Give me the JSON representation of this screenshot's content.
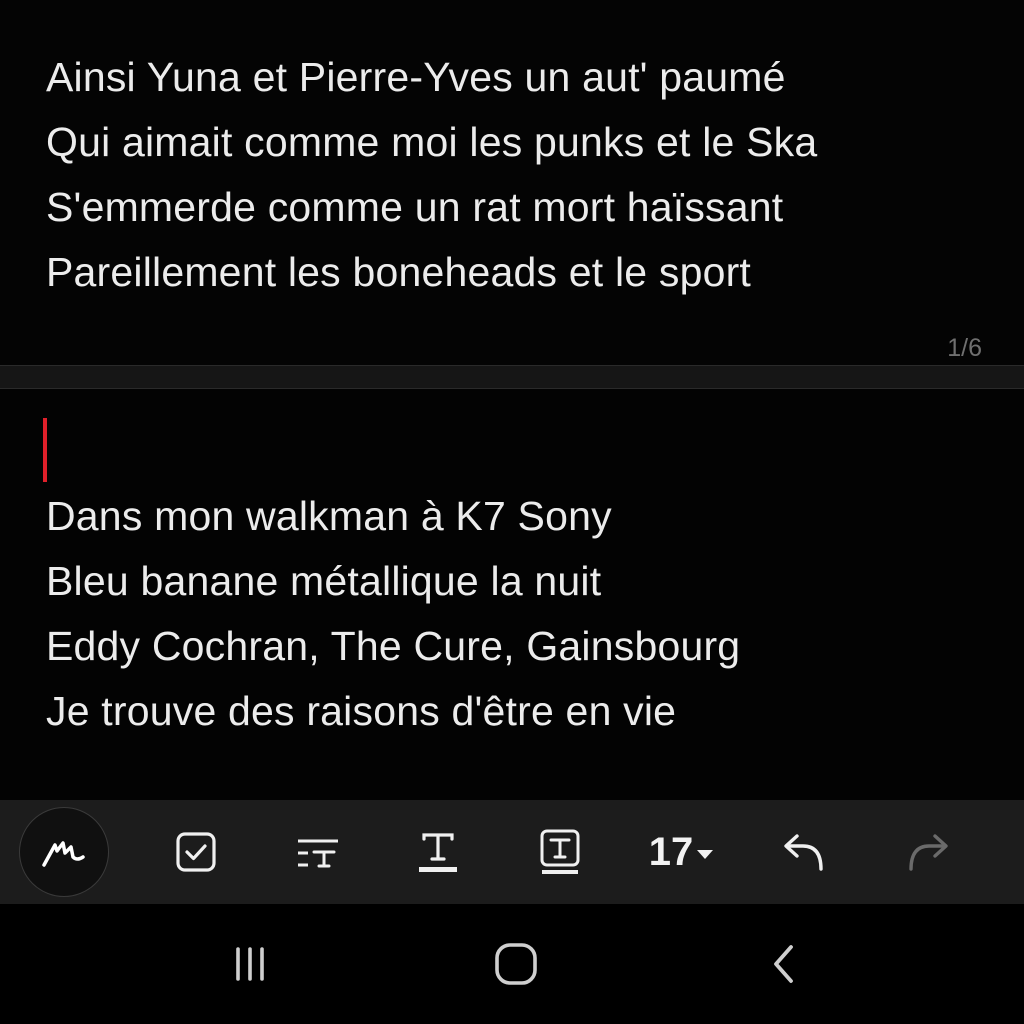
{
  "note": {
    "top_lines": [
      "Ainsi Yuna et Pierre-Yves un aut' paumé",
      "Qui aimait comme moi les punks et le Ska",
      "S'emmerde comme un rat mort haïssant",
      "Pareillement les boneheads et le sport"
    ],
    "page_indicator": "1/6",
    "bottom_lines": [
      "Dans mon walkman à K7 Sony",
      "Bleu banane métallique la nuit",
      "Eddy Cochran, The Cure, Gainsbourg",
      "Je trouve des raisons d'être en vie"
    ]
  },
  "toolbar": {
    "items": [
      {
        "icon": "handwriting-pen-icon"
      },
      {
        "icon": "checkbox-icon"
      },
      {
        "icon": "text-style-icon"
      },
      {
        "icon": "text-color-icon"
      },
      {
        "icon": "text-highlight-icon"
      },
      {
        "icon": "font-size-dropdown"
      },
      {
        "icon": "undo-icon"
      },
      {
        "icon": "redo-icon"
      }
    ],
    "font_size": "17"
  },
  "navbar": {
    "items": [
      {
        "icon": "recent-apps-icon"
      },
      {
        "icon": "home-icon"
      },
      {
        "icon": "back-icon"
      }
    ]
  },
  "colors": {
    "background": "#000000",
    "text": "#ececec",
    "cursor": "#e0202a",
    "toolbar": "#1c1c1c",
    "disabled_icon": "#6a6a6a"
  }
}
